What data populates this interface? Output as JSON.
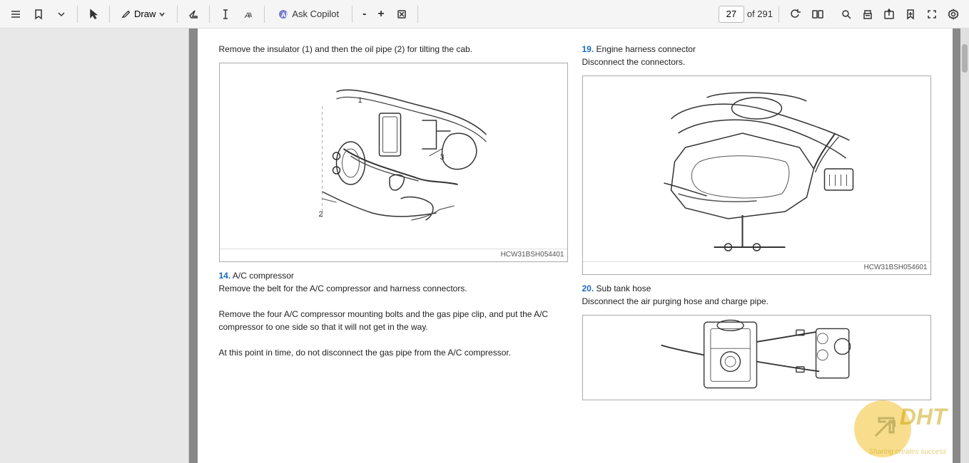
{
  "toolbar": {
    "page_number": "27",
    "total_pages": "of 291",
    "draw_label": "Draw",
    "ask_copilot_label": "Ask Copilot",
    "zoom_minus": "-",
    "zoom_plus": "+",
    "buttons": [
      "menu",
      "bookmark",
      "bookmark-down",
      "draw-mode",
      "draw",
      "eraser",
      "text-highlight",
      "text",
      "font-style",
      "ask-copilot",
      "zoom-out",
      "zoom-in",
      "fit",
      "page-input",
      "of-291",
      "rotate",
      "multi-page",
      "search",
      "print",
      "share",
      "bookmark-add",
      "expand",
      "settings"
    ]
  },
  "content": {
    "left_column": {
      "instruction_18_text": "Remove the insulator (1) and then the oil pipe (2) for tilting the cab.",
      "image1_caption": "HCW31BSH054401",
      "instruction_14_number": "14.",
      "instruction_14_title": "A/C compressor",
      "instruction_14_text1": "Remove the belt for the A/C compressor and harness connectors.",
      "instruction_14_text2": "Remove the four A/C compressor mounting bolts and the gas pipe clip, and put the A/C compressor to one side so that it will not get in the way.",
      "instruction_14_text3": "At this point in time, do not disconnect the gas pipe from the A/C compressor."
    },
    "right_column": {
      "instruction_19_number": "19.",
      "instruction_19_title": "Engine harness connector",
      "instruction_19_text": "Disconnect the connectors.",
      "image2_caption": "HCW31BSH054601",
      "instruction_20_number": "20.",
      "instruction_20_title": "Sub tank hose",
      "instruction_20_text": "Disconnect the air purging hose and charge pipe."
    }
  },
  "watermark": {
    "brand": "DHT",
    "tagline": "Sharing creates success"
  }
}
